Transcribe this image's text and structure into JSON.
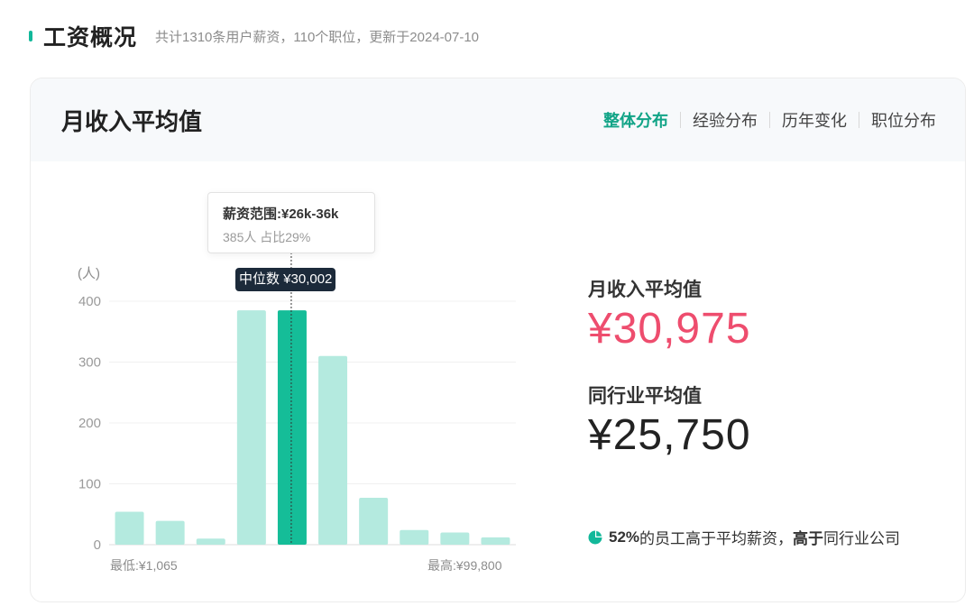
{
  "header": {
    "title": "工资概况",
    "subtitle": "共计1310条用户薪资，110个职位，更新于2024-07-10"
  },
  "card": {
    "title": "月收入平均值",
    "tabs": [
      {
        "label": "整体分布",
        "active": true
      },
      {
        "label": "经验分布",
        "active": false
      },
      {
        "label": "历年变化",
        "active": false
      },
      {
        "label": "职位分布",
        "active": false
      }
    ]
  },
  "tooltip": {
    "range": "薪资范围:¥26k-36k",
    "detail": "385人  占比29%"
  },
  "median_label": "中位数 ¥30,002",
  "min_label": "最低:¥1,065",
  "max_label": "最高:¥99,800",
  "stats": {
    "avg_label": "月收入平均值",
    "avg_value": "¥30,975",
    "industry_label": "同行业平均值",
    "industry_value": "¥25,750"
  },
  "footnote": {
    "percent": "52%",
    "text1": "的员工高于平均薪资，",
    "emphasis": "高于",
    "text2": "同行业公司"
  },
  "colors": {
    "accent": "#12b89a",
    "bar": "#b4eadf",
    "bar_highlight": "#15bd98",
    "avg_value": "#ee4d6e"
  },
  "chart_data": {
    "type": "bar",
    "yunit": "(人)",
    "yticks": [
      0,
      100,
      200,
      300,
      400
    ],
    "ylim": [
      0,
      400
    ],
    "values": [
      54,
      39,
      10,
      385,
      385,
      310,
      77,
      24,
      20,
      12
    ],
    "highlight_index": 4,
    "grid": true
  }
}
